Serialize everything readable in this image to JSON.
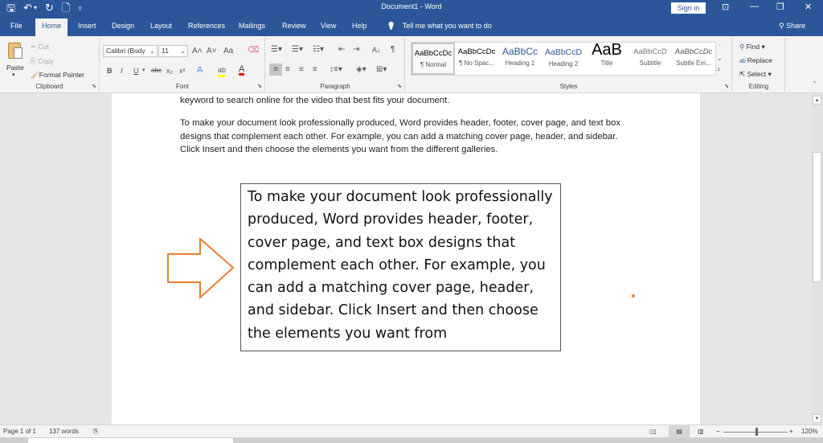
{
  "titlebar": {
    "title": "Document1 - Word",
    "signin_label": "Sign in",
    "qat": {
      "save": "🖫",
      "undo": "↶",
      "undo_dropdown": "▾",
      "redo": "↻",
      "new": "🗋",
      "customize": "▿"
    },
    "controls": {
      "ribbon_display": "⊡",
      "minimize": "—",
      "restore": "❐",
      "close": "✕"
    }
  },
  "tabs": [
    "File",
    "Home",
    "Insert",
    "Design",
    "Layout",
    "References",
    "Mailings",
    "Review",
    "View",
    "Help"
  ],
  "active_tab": "Home",
  "tellme": {
    "icon": "💡",
    "placeholder": "Tell me what you want to do"
  },
  "share_label": "Share",
  "ribbon": {
    "clipboard": {
      "label": "Clipboard",
      "paste": "Paste",
      "cut": "Cut",
      "copy": "Copy",
      "format_painter": "Format Painter"
    },
    "font": {
      "label": "Font",
      "font_name": "Calibri (Body",
      "font_size": "11",
      "grow": "A˄",
      "shrink": "A˅",
      "change_case": "Aa",
      "bold": "B",
      "italic": "I",
      "underline": "U",
      "strikethrough": "abc",
      "subscript": "x₂",
      "superscript": "x²",
      "text_effects": "A",
      "highlight": "ab",
      "font_color": "A",
      "highlight_color": "#ffff00",
      "font_color_value": "#ff0000"
    },
    "paragraph": {
      "label": "Paragraph",
      "show_marks": "¶",
      "sort": "A↓"
    },
    "styles": {
      "label": "Styles",
      "items": [
        {
          "sample": "AaBbCcDc",
          "name": "¶ Normal",
          "selected": true
        },
        {
          "sample": "AaBbCcDc",
          "name": "¶ No Spac..."
        },
        {
          "sample": "AaBbCc",
          "name": "Heading 1"
        },
        {
          "sample": "AaBbCcD",
          "name": "Heading 2"
        },
        {
          "sample": "AaB",
          "name": "Title"
        },
        {
          "sample": "AaBbCcD",
          "name": "Subtitle"
        },
        {
          "sample": "AaBbCcDc",
          "name": "Subtle Em..."
        }
      ]
    },
    "editing": {
      "label": "Editing",
      "find": "Find",
      "replace": "Replace",
      "select": "Select"
    }
  },
  "document": {
    "para1_tail": "keyword to search online for the video that best fits your document.",
    "para2": "To make your document look professionally produced, Word provides header, footer, cover page, and text box designs that complement each other. For example, you can add a matching cover page, header, and sidebar. Click Insert and then choose the elements you want from the different galleries.",
    "textbox": "To make your document look professionally produced, Word provides header, footer, cover page, and text box designs that complement each other. For example, you can add a matching cover page, header, and sidebar. Click Insert and then choose the elements you want from",
    "arrow_color": "#ed7d31"
  },
  "status": {
    "page": "Page 1 of 1",
    "words": "137 words",
    "zoom": "120%",
    "zoom_minus": "−",
    "zoom_plus": "+"
  }
}
